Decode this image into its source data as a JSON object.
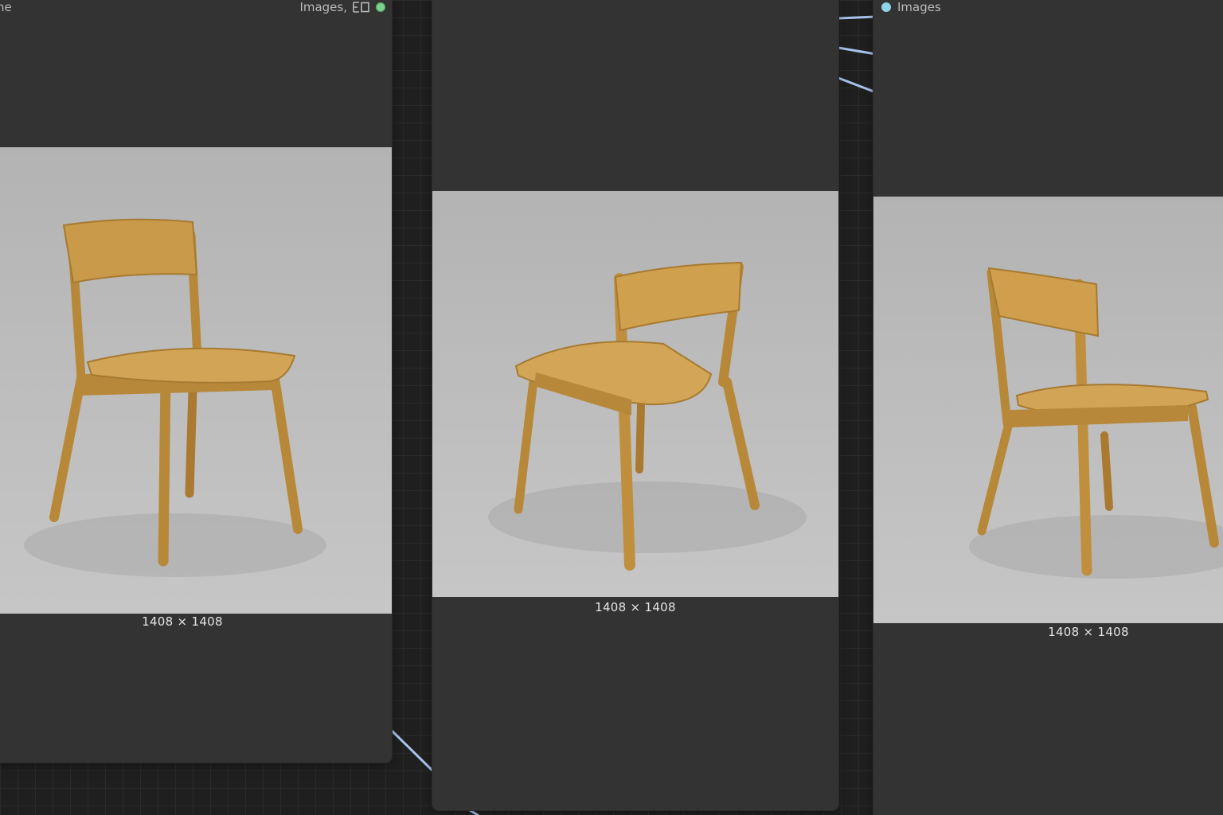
{
  "canvas": {
    "background": "#1f1f1f",
    "wire_color": "#a9c3ee"
  },
  "nodes": [
    {
      "id": "left",
      "title_partial": "ne",
      "header_label": "Images,",
      "toggle_icon": "split-view-icon",
      "status_color": "#7bd389",
      "caption": "1408 × 1408",
      "image_subject": "wooden-chair-front-view"
    },
    {
      "id": "middle",
      "caption": "1408 × 1408",
      "image_subject": "wooden-chair-back-view"
    },
    {
      "id": "right",
      "status_color": "#8fd3e8",
      "header_label": "Images",
      "caption": "1408 × 1408",
      "image_subject": "wooden-chair-rear-side-view"
    }
  ]
}
